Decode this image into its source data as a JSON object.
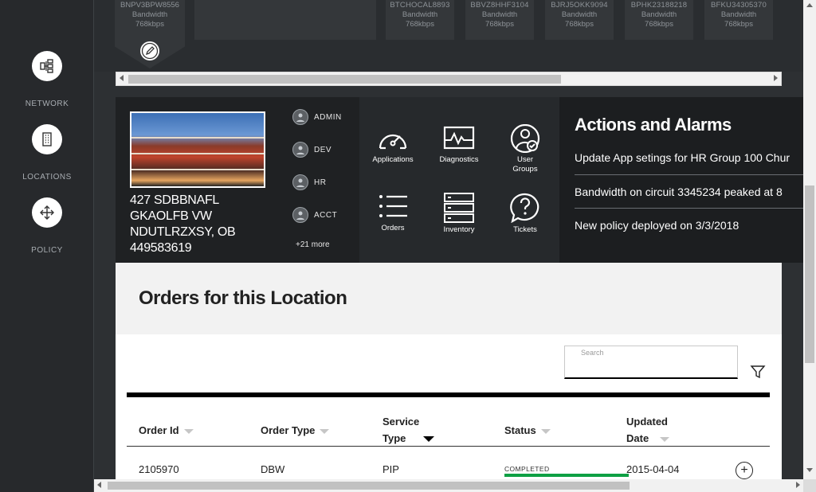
{
  "sidenav": {
    "items": [
      {
        "label": "NETWORK",
        "icon": "network-icon"
      },
      {
        "label": "LOCATIONS",
        "icon": "building-icon"
      },
      {
        "label": "POLICY",
        "icon": "move-arrows-icon"
      }
    ]
  },
  "circuits": [
    {
      "id": "BNPV3BPW8556",
      "label": "Bandwidth",
      "speed": "768kbps"
    },
    {
      "id": "BTCHOCAL8893",
      "label": "Bandwidth",
      "speed": "768kbps"
    },
    {
      "id": "BBVZ8HHF3104",
      "label": "Bandwidth",
      "speed": "768kbps"
    },
    {
      "id": "BJRJ5OKK9094",
      "label": "Bandwidth",
      "speed": "768kbps"
    },
    {
      "id": "BPHK23188218",
      "label": "Bandwidth",
      "speed": "768kbps"
    },
    {
      "id": "BFKU34305370",
      "label": "Bandwidth",
      "speed": "768kbps"
    }
  ],
  "location": {
    "address_line1": "427 SDBBNAFL",
    "address_line2": "GKAOLFB VW",
    "address_line3": "NDUTLRZXSY, OB",
    "address_line4": "449583619",
    "groups": [
      "ADMIN",
      "DEV",
      "HR",
      "ACCT"
    ],
    "more": "+21 more"
  },
  "apps": [
    {
      "label": "Applications",
      "icon": "gauge-icon"
    },
    {
      "label": "Diagnostics",
      "icon": "pulse-icon"
    },
    {
      "label": "User\nGroups",
      "label1": "User",
      "label2": "Groups",
      "icon": "user-check-icon"
    },
    {
      "label": "Orders",
      "icon": "list-icon"
    },
    {
      "label": "Inventory",
      "icon": "server-icon"
    },
    {
      "label": "Tickets",
      "icon": "question-bubble-icon"
    }
  ],
  "alarms": {
    "title": "Actions and Alarms",
    "items": [
      "Update App setings for HR Group 100 Chur",
      "Bandwidth on circuit 3345234 peaked at 8",
      "New policy deployed on 3/3/2018"
    ]
  },
  "orders": {
    "title": "Orders for this Location",
    "search_placeholder": "Search",
    "columns": {
      "order_id": "Order Id",
      "order_type": "Order Type",
      "service_type_1": "Service",
      "service_type_2": "Type",
      "status": "Status",
      "updated_1": "Updated",
      "updated_2": "Date"
    },
    "rows": [
      {
        "order_id": "2105970",
        "order_type": "DBW",
        "service_type": "PIP",
        "status": "COMPLETED",
        "updated": "2015-04-04",
        "progress": 1.0
      }
    ]
  },
  "colors": {
    "status_complete": "#0ea044",
    "sidebar_bg": "#27292c"
  }
}
